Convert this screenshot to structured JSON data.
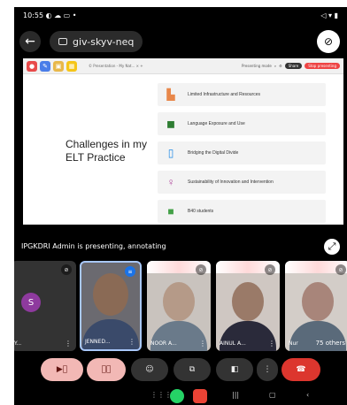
{
  "statusbar": {
    "time": "10:55",
    "left_icons": "◐ ☁ ▭ •",
    "right_icons": "◁ ▾ ▮"
  },
  "browser": {
    "back_icon": "←",
    "meeting_code": "giv-skyv-neq",
    "close_icon": "⊘"
  },
  "slide_browserbar": {
    "tab_title": "© Presentation - My Nat... ×  +",
    "right_label": "Presenting mode",
    "share_label": "Share",
    "stop_label": "Stop presenting"
  },
  "annotation_tools": [
    {
      "name": "record",
      "color": "#e84a4a",
      "glyph": "●"
    },
    {
      "name": "pen",
      "color": "#4a7de8",
      "glyph": "✎"
    },
    {
      "name": "highlighter",
      "color": "#e8b84a",
      "glyph": "▣"
    },
    {
      "name": "clear",
      "color": "#f5c518",
      "glyph": "▦"
    }
  ],
  "slide": {
    "title": "Challenges in my ELT Practice",
    "items": [
      {
        "label": "Limited Infrastructure and Resources",
        "icon": "building-icon",
        "color": "#e8874a"
      },
      {
        "label": "Language Exposure and Use",
        "icon": "chat-icon",
        "color": "#2e7d32"
      },
      {
        "label": "Bridging the Digital Divide",
        "icon": "phone-icon",
        "color": "#1e88e5"
      },
      {
        "label": "Sustainability of Innovation and Intervention",
        "icon": "bulb-icon",
        "color": "#b04a9e"
      },
      {
        "label": "B40 students",
        "icon": "square-icon",
        "color": "#43a047"
      }
    ]
  },
  "presenting_text": "IPGKDRI Admin is presenting, annotating",
  "participants": [
    {
      "name": "Y...",
      "type": "avatar",
      "initial": "S"
    },
    {
      "name": "JENNED...",
      "type": "video"
    },
    {
      "name": "NOOR A...",
      "type": "video"
    },
    {
      "name": "AINUL A...",
      "type": "video"
    },
    {
      "name": "Nur",
      "type": "video",
      "others": "75 others"
    }
  ],
  "controls": [
    {
      "name": "camera-off",
      "glyph": "▶⃠"
    },
    {
      "name": "mic-off",
      "glyph": "🎙⃠"
    },
    {
      "name": "reactions",
      "glyph": "☺"
    },
    {
      "name": "present",
      "glyph": "⧉"
    },
    {
      "name": "captions",
      "glyph": "◧"
    },
    {
      "name": "more",
      "glyph": "⋮"
    },
    {
      "name": "leave",
      "glyph": "☎"
    }
  ],
  "navbar": {
    "apps": "⋮⋮⋮",
    "recent": "|||",
    "home": "▢",
    "back": "‹"
  }
}
